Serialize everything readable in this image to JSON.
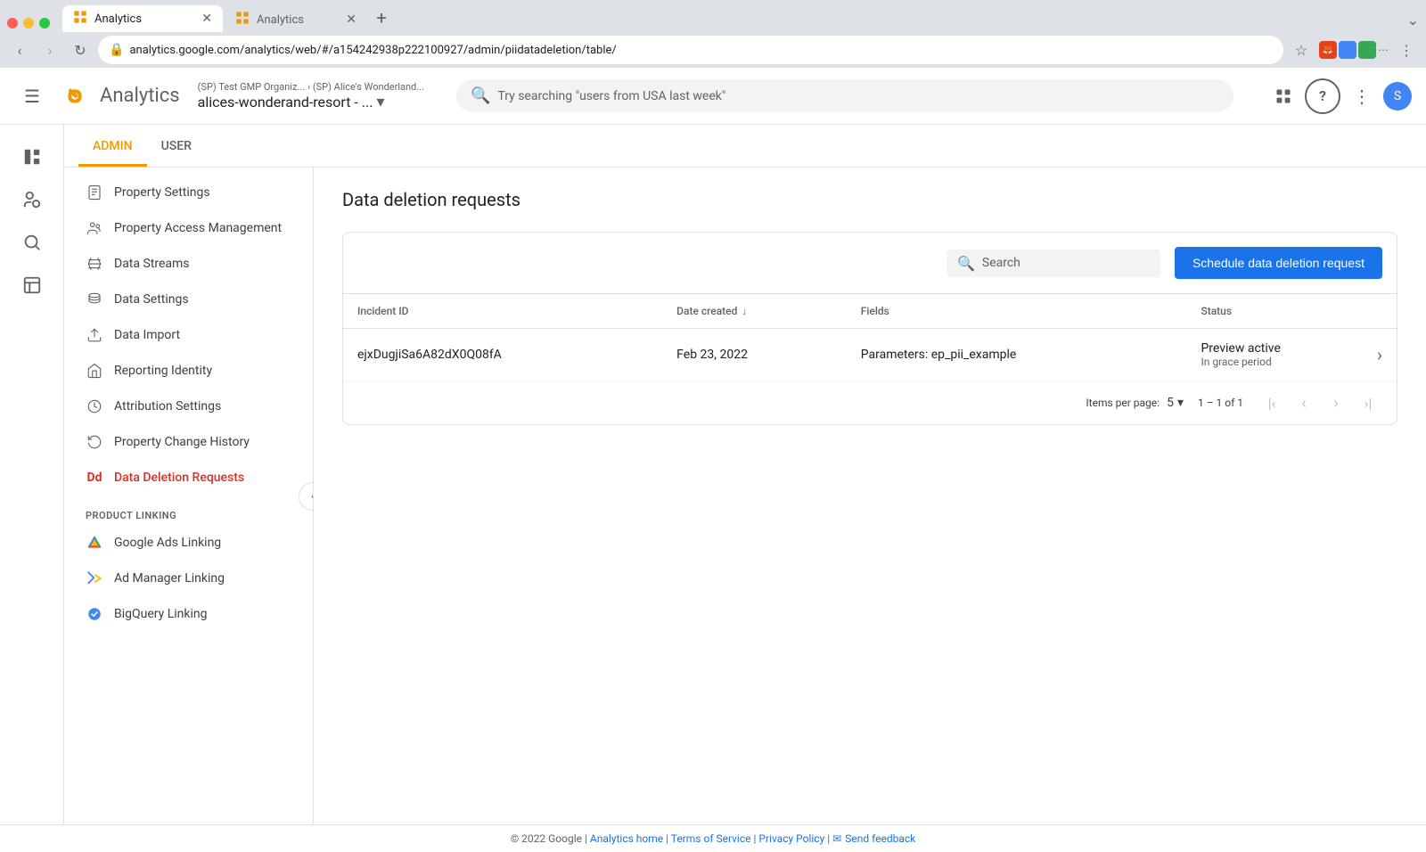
{
  "browser": {
    "tabs": [
      {
        "id": "tab1",
        "favicon": "📊",
        "label": "Analytics",
        "active": true
      },
      {
        "id": "tab2",
        "favicon": "📊",
        "label": "Analytics",
        "active": false
      }
    ],
    "url": "analytics.google.com/analytics/web/#/a154242938p222100927/admin/piidatadeletion/table/"
  },
  "header": {
    "app_name": "Analytics",
    "breadcrumb": "(SP) Test GMP Organiz... › (SP) Alice's Wonderland...",
    "property_name": "alices-wonderand-resort - ...",
    "search_placeholder": "Try searching \"users from USA last week\"",
    "apps_icon": "⊞",
    "help_icon": "?",
    "more_icon": "⋮"
  },
  "left_nav": {
    "icons": [
      {
        "id": "home",
        "icon": "📊",
        "label": "Home"
      },
      {
        "id": "reports",
        "icon": "👥",
        "label": "Reports"
      },
      {
        "id": "explore",
        "icon": "🔍",
        "label": "Explore"
      },
      {
        "id": "advertising",
        "icon": "📋",
        "label": "Advertising"
      }
    ]
  },
  "admin_tabs": [
    {
      "id": "admin",
      "label": "ADMIN",
      "active": true
    },
    {
      "id": "user",
      "label": "USER",
      "active": false
    }
  ],
  "sidebar": {
    "items": [
      {
        "id": "property-settings",
        "label": "Property Settings",
        "icon": "page"
      },
      {
        "id": "property-access",
        "label": "Property Access Management",
        "icon": "people"
      },
      {
        "id": "data-streams",
        "label": "Data Streams",
        "icon": "streams"
      },
      {
        "id": "data-settings",
        "label": "Data Settings",
        "icon": "stack"
      },
      {
        "id": "data-import",
        "label": "Data Import",
        "icon": "upload"
      },
      {
        "id": "reporting-identity",
        "label": "Reporting Identity",
        "icon": "identity"
      },
      {
        "id": "attribution-settings",
        "label": "Attribution Settings",
        "icon": "attribution"
      },
      {
        "id": "property-change-history",
        "label": "Property Change History",
        "icon": "history"
      },
      {
        "id": "data-deletion-requests",
        "label": "Data Deletion Requests",
        "icon": "dd",
        "active": true
      }
    ],
    "sections": [
      {
        "label": "PRODUCT LINKING",
        "items": [
          {
            "id": "google-ads",
            "label": "Google Ads Linking",
            "icon": "ads"
          },
          {
            "id": "ad-manager",
            "label": "Ad Manager Linking",
            "icon": "admanager"
          },
          {
            "id": "bigquery",
            "label": "BigQuery Linking",
            "icon": "bigquery"
          }
        ]
      }
    ]
  },
  "main": {
    "page_title": "Data deletion requests",
    "search_placeholder": "Search",
    "schedule_btn_label": "Schedule data deletion request",
    "table": {
      "columns": [
        {
          "id": "incident_id",
          "label": "Incident ID",
          "sortable": false
        },
        {
          "id": "date_created",
          "label": "Date created",
          "sortable": true
        },
        {
          "id": "fields",
          "label": "Fields",
          "sortable": false
        },
        {
          "id": "status",
          "label": "Status",
          "sortable": false
        }
      ],
      "rows": [
        {
          "incident_id": "ejxDugjiSa6A82dX0Q08fA",
          "date_created": "Feb 23, 2022",
          "fields": "Parameters: ep_pii_example",
          "status_main": "Preview active",
          "status_sub": "In grace period"
        }
      ]
    },
    "pagination": {
      "items_per_page_label": "Items per page:",
      "per_page_value": "5",
      "page_info": "1 – 1 of 1"
    }
  },
  "footer": {
    "copyright": "© 2022 Google",
    "links": [
      {
        "label": "Analytics home",
        "href": "#"
      },
      {
        "label": "Terms of Service",
        "href": "#"
      },
      {
        "label": "Privacy Policy",
        "href": "#"
      },
      {
        "label": "Send feedback",
        "href": "#",
        "icon": "✉"
      }
    ]
  }
}
